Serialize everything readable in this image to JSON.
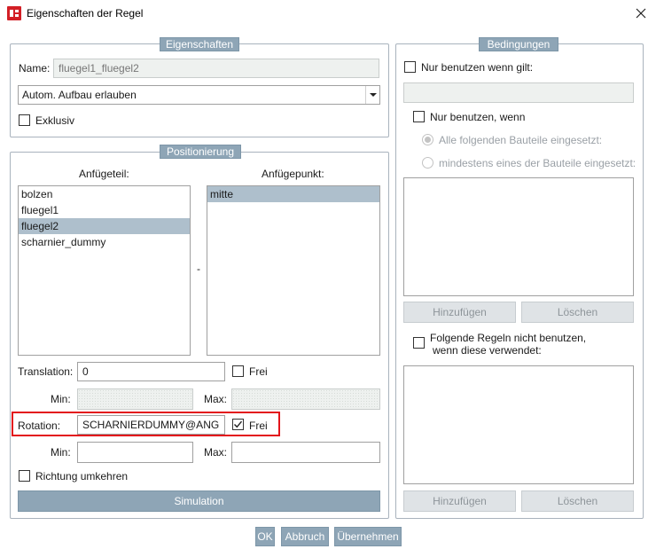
{
  "window": {
    "title": "Eigenschaften der Regel",
    "icon": "app-logo-icon",
    "close_icon": "close-icon"
  },
  "eigenschaften": {
    "legend": "Eigenschaften",
    "name_label": "Name:",
    "name_value": "fluegel1_fluegel2",
    "dropdown_value": "Autom. Aufbau erlauben",
    "exklusiv_label": "Exklusiv",
    "exklusiv_checked": false
  },
  "positionierung": {
    "legend": "Positionierung",
    "anfuegeteil_label": "Anfügeteil:",
    "anfuegepunkt_label": "Anfügepunkt:",
    "anfuegeteil_items": [
      "bolzen",
      "fluegel1",
      "fluegel2",
      "scharnier_dummy"
    ],
    "anfuegeteil_selected": 2,
    "anfuegepunkt_items": [
      "mitte"
    ],
    "anfuegepunkt_selected": 0,
    "separator": "-",
    "translation_label": "Translation:",
    "translation_value": "0",
    "translation_frei_label": "Frei",
    "translation_frei_checked": false,
    "min_label": "Min:",
    "max_label": "Max:",
    "rotation_label": "Rotation:",
    "rotation_value": "SCHARNIERDUMMY@ANG",
    "rotation_frei_label": "Frei",
    "rotation_frei_checked": true,
    "rotation_min_label": "Min:",
    "rotation_max_label": "Max:",
    "richtung_label": "Richtung umkehren",
    "richtung_checked": false,
    "simulation_label": "Simulation"
  },
  "bedingungen": {
    "legend": "Bedingungen",
    "nur_gilt_label": "Nur benutzen wenn gilt:",
    "nur_wenn_label": "Nur benutzen, wenn",
    "radio_alle_label": "Alle folgenden Bauteile eingesetzt:",
    "radio_mind_label": "mindestens eines der Bauteile eingesetzt:",
    "hinzufuegen_label": "Hinzufügen",
    "loeschen_label": "Löschen",
    "folgende_label_1": "Folgende Regeln nicht benutzen,",
    "folgende_label_2": "wenn diese verwendet:",
    "hinzufuegen2_label": "Hinzufügen",
    "loeschen2_label": "Löschen"
  },
  "footer": {
    "ok": "OK",
    "abbruch": "Abbruch",
    "uebernehmen": "Übernehmen"
  },
  "colors": {
    "accent": "#8ea5b6",
    "selection": "#aebfcc",
    "highlight": "#e3141b"
  }
}
